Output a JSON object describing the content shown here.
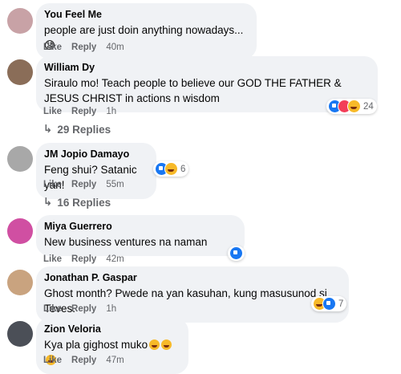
{
  "comments": [
    {
      "name": "You Feel Me",
      "text": "people are just doin anything nowadays... 😧",
      "like": "Like",
      "reply": "Reply",
      "time": "40m",
      "avatar_color": "#c8a2a6"
    },
    {
      "name": "William Dy",
      "text": "Siraulo mo! Teach people to believe our GOD THE FATHER & JESUS CHRIST in actions n wisdom",
      "like": "Like",
      "reply": "Reply",
      "time": "1h",
      "reactions": "24",
      "replies": "29 Replies",
      "avatar_color": "#8a6d58"
    },
    {
      "name": "JM Jopio Damayo",
      "text": "Feng shui? Satanic yan!",
      "like": "Like",
      "reply": "Reply",
      "time": "55m",
      "reactions": "6",
      "replies": "16 Replies",
      "avatar_color": "#a8a8a8"
    },
    {
      "name": "Miya Guerrero",
      "text": "New business ventures na naman",
      "like": "Like",
      "reply": "Reply",
      "time": "42m",
      "avatar_color": "#d04fa2"
    },
    {
      "name": "Jonathan P. Gaspar",
      "text": "Ghost month? Pwede na yan kasuhan, kung masusunod si Teves.",
      "like": "Like",
      "reply": "Reply",
      "time": "1h",
      "reactions": "7",
      "avatar_color": "#c9a37f"
    },
    {
      "name": "Zion Veloria",
      "text": "Kya pla gighost muko",
      "like": "Like",
      "reply": "Reply",
      "time": "47m",
      "avatar_color": "#4b4f57"
    }
  ]
}
